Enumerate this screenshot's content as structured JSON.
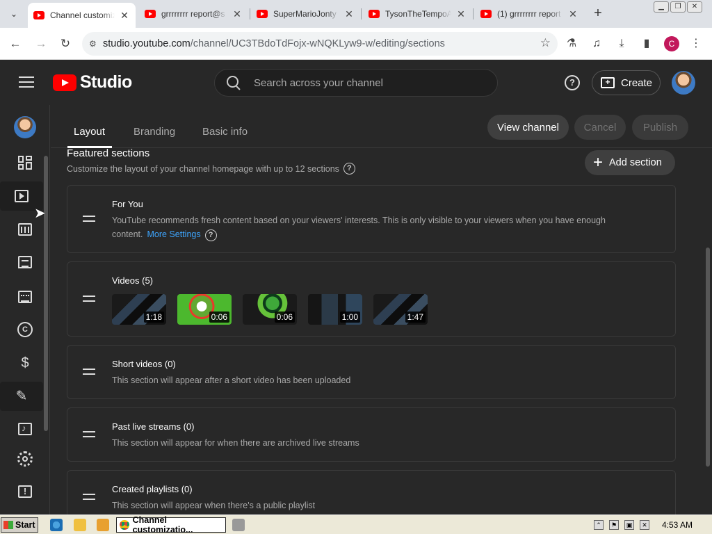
{
  "browser": {
    "tabs": [
      {
        "title": "Channel customiza",
        "active": true
      },
      {
        "title": "grrrrrrrr report@s",
        "active": false
      },
      {
        "title": "SuperMarioJonty -",
        "active": false
      },
      {
        "title": "TysonTheTempoA",
        "active": false
      },
      {
        "title": "(1) grrrrrrrr report",
        "active": false
      }
    ],
    "close_glyph": "✕",
    "new_tab_glyph": "+",
    "url_host": "studio.youtube.com",
    "url_path": "/channel/UC3TBdoTdFojx-wNQKLyw9-w/editing/sections",
    "profile_initial": "C"
  },
  "studio": {
    "logo_text": "Studio",
    "search_placeholder": "Search across your channel",
    "create_label": "Create",
    "tabs": [
      "Layout",
      "Branding",
      "Basic info"
    ],
    "view_channel_label": "View channel",
    "cancel_label": "Cancel",
    "publish_label": "Publish",
    "featured_title": "Featured sections",
    "featured_desc": "Customize the layout of your channel homepage with up to 12 sections",
    "add_section_label": "Add section",
    "sections": [
      {
        "title": "For You",
        "desc": "YouTube recommends fresh content based on your viewers' interests. This is only visible to your viewers when you have enough content.",
        "link": "More Settings"
      },
      {
        "title": "Videos (5)",
        "durations": [
          "1:18",
          "0:06",
          "0:06",
          "1:00",
          "1:47"
        ]
      },
      {
        "title": "Short videos (0)",
        "desc": "This section will appear after a short video has been uploaded"
      },
      {
        "title": "Past live streams (0)",
        "desc": "This section will appear for when there are archived live streams"
      },
      {
        "title": "Created playlists (0)",
        "desc": "This section will appear when there's a public playlist"
      }
    ]
  },
  "taskbar": {
    "start_label": "Start",
    "task_label": "Channel customizatio...",
    "clock": "4:53 AM"
  },
  "colors": {
    "accent": "#ff0000",
    "link": "#3ea6ff",
    "background": "#282828"
  }
}
